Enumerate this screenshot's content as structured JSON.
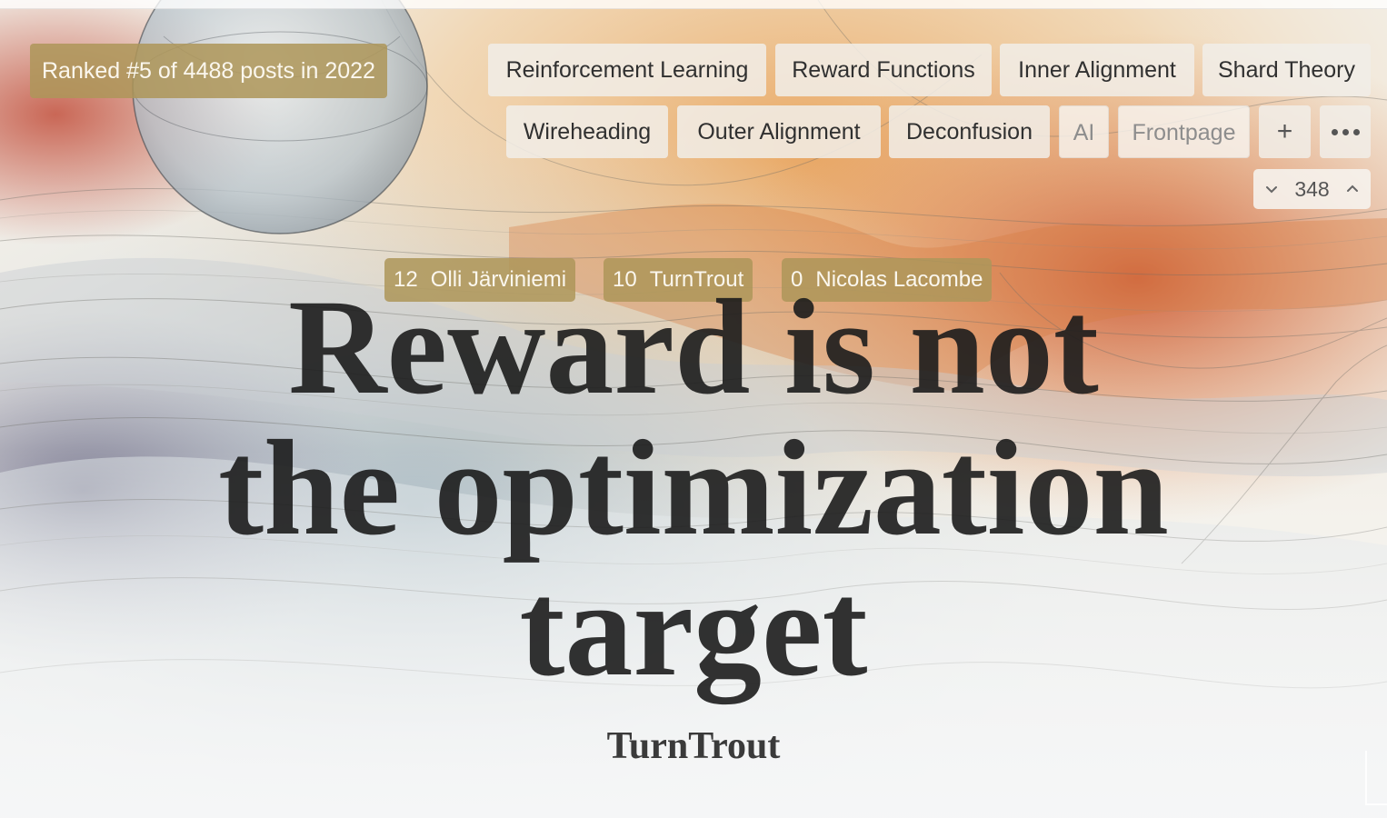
{
  "ranking": "Ranked #5 of 4488 posts in 2022",
  "tags": [
    "Reinforcement Learning",
    "Reward Functions",
    "Inner Alignment",
    "Shard Theory",
    "Wireheading",
    "Outer Alignment",
    "Deconfusion",
    "AI",
    "Frontpage"
  ],
  "tag_actions": {
    "add": "+",
    "more_icon": "ellipsis-icon"
  },
  "vote": {
    "score": "348",
    "down_icon": "chevron-down-icon",
    "up_icon": "chevron-up-icon"
  },
  "coauthors": [
    {
      "karma": "12",
      "name": "Olli Järviniemi"
    },
    {
      "karma": "10",
      "name": "TurnTrout"
    },
    {
      "karma": "0",
      "name": "Nicolas Lacombe"
    }
  ],
  "post": {
    "title_lines": [
      "Reward is not",
      "the optimization",
      "target"
    ],
    "author": "TurnTrout"
  },
  "colors": {
    "badge": "#ae965a",
    "title": "#1c1c1c",
    "accent_orange": "#d9843d"
  }
}
